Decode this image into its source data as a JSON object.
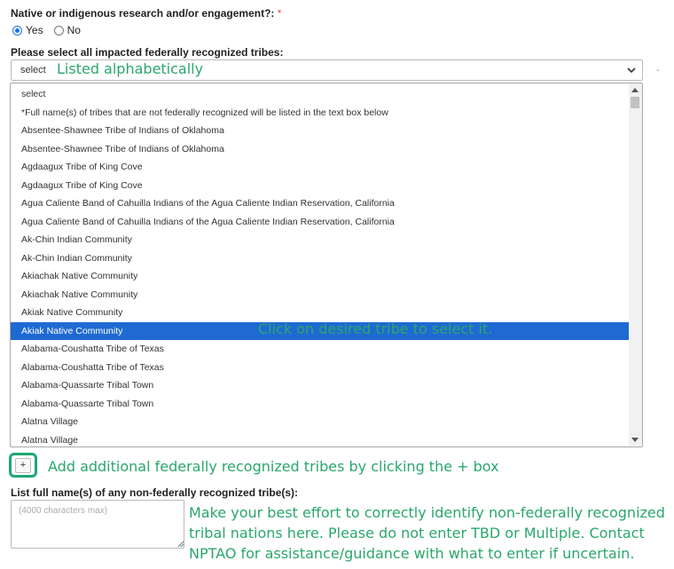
{
  "question": {
    "label": "Native or indigenous research and/or engagement?:",
    "required_mark": "*",
    "options": [
      {
        "label": "Yes",
        "checked": true
      },
      {
        "label": "No",
        "checked": false
      }
    ]
  },
  "tribes": {
    "label": "Please select all impacted federally recognized tribes:",
    "select_value": "select",
    "dash": "-",
    "options": [
      "select",
      "*Full name(s) of tribes that are not federally recognized will be listed in the text box below",
      "Absentee-Shawnee Tribe of Indians of Oklahoma",
      "Absentee-Shawnee Tribe of Indians of Oklahoma",
      "Agdaagux Tribe of King Cove",
      "Agdaagux Tribe of King Cove",
      "Agua Caliente Band of Cahuilla Indians of the Agua Caliente Indian Reservation, California",
      "Agua Caliente Band of Cahuilla Indians of the Agua Caliente Indian Reservation, California",
      "Ak-Chin Indian Community",
      "Ak-Chin Indian Community",
      "Akiachak Native Community",
      "Akiachak Native Community",
      "Akiak Native Community",
      "Akiak Native Community",
      "Alabama-Coushatta Tribe of Texas",
      "Alabama-Coushatta Tribe of Texas",
      "Alabama-Quassarte Tribal Town",
      "Alabama-Quassarte Tribal Town",
      "Alatna Village",
      "Alatna Village"
    ],
    "selected_index": 13,
    "add_button_label": "+"
  },
  "nonfederal": {
    "label": "List full name(s) of any non-federally recognized tribe(s):",
    "placeholder": "(4000 characters max)",
    "value": ""
  },
  "annotations": {
    "listed": "Listed alphabetically",
    "click": "Click on desired tribe to select it.",
    "add": "Add additional federally recognized tribes by clicking the + box",
    "note": "Make your best effort to correctly identify non-federally recognized tribal nations here. Please do not enter TBD or Multiple. Contact NPTAO for assistance/guidance with what to enter if uncertain."
  },
  "colors": {
    "annotation": "#2aa76b",
    "selected_option": "#1f6ad2",
    "highlight_border": "#1fa673",
    "required": "#d9534f"
  }
}
